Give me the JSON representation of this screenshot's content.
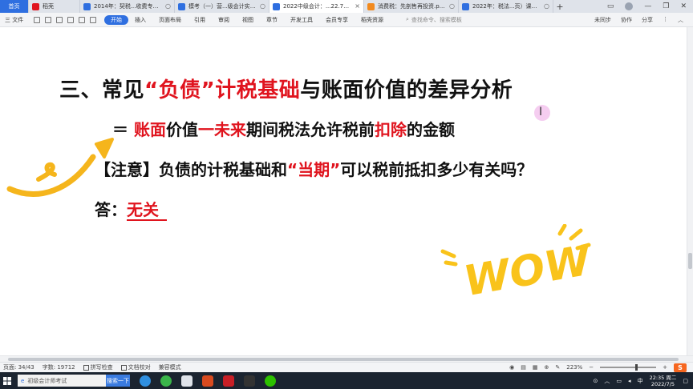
{
  "tabs": [
    {
      "label": "首页",
      "kind": "home"
    },
    {
      "label": "稻壳",
      "color": "#e0141e"
    },
    {
      "label": "2014年：契税...收费专项1-41",
      "color": "#2f6fe0"
    },
    {
      "label": "模考（一）营...级会计实务2",
      "color": "#2f6fe0"
    },
    {
      "label": "2022中级会计：...22.7.1 网课",
      "color": "#2f6fe0",
      "active": true
    },
    {
      "label": "消费税：先剖售再投资.pptx",
      "color": "#f28a1e"
    },
    {
      "label": "2022年：税法...页）课堂6.13",
      "color": "#2f6fe0"
    }
  ],
  "menu": {
    "file": "三 文件",
    "items": [
      "开始",
      "插入",
      "页面布局",
      "引用",
      "审阅",
      "视图",
      "章节",
      "开发工具",
      "会员专享",
      "稻壳资源"
    ],
    "selected": "开始",
    "search_placeholder": "查找命令、搜索模板",
    "right_tools": [
      "未同步",
      "协作",
      "分享"
    ]
  },
  "doc": {
    "title_a": "三、常见",
    "title_b": "“负债”",
    "title_c": "计税基础",
    "title_d": "与账面价值的差异分析",
    "line2_a": "＝ ",
    "line2_b": "账面",
    "line2_c": "价值",
    "line2_d": "一未来",
    "line2_e": "期间税法允许税前",
    "line2_f": "扣除",
    "line2_g": "的金额",
    "line3_a": "【注意】负债的计税基础和",
    "line3_b": "“当期”",
    "line3_c": "可以税前抵扣多少有关吗？",
    "line4_a": "答：",
    "line4_b": "无关",
    "sticker_text": "WOW"
  },
  "status": {
    "page": "页面: 34/43",
    "words": "字数: 19712",
    "spell": "拼写检查",
    "proof": "文档校对",
    "compat": "兼容模式",
    "zoom": "223%",
    "ime": "S"
  },
  "taskbar": {
    "search_text": "初级会计师考试",
    "search_button": "搜索一下",
    "time": "22:35 周二",
    "date": "2022/7/5"
  },
  "colors": {
    "accent": "#2f6fe0",
    "highlight_red": "#e0141e",
    "arrow_yellow": "#f5b51c",
    "wow_yellow": "#f9c31b"
  }
}
